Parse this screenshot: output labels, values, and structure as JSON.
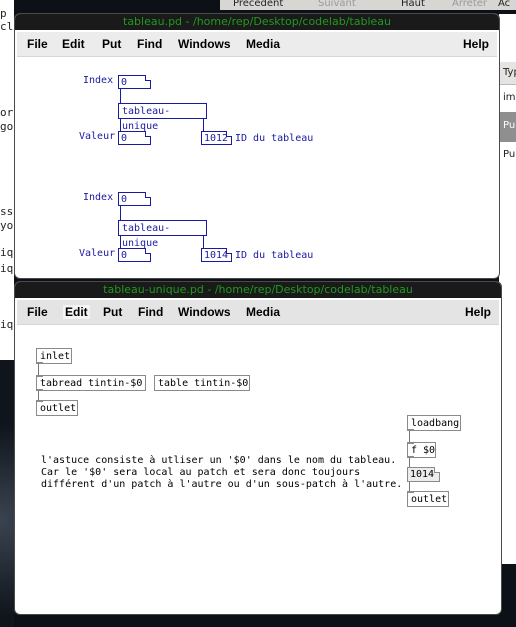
{
  "browser_bar": {
    "previous": "Précédent",
    "next": "Suivant",
    "up": "Haut",
    "stop": "Arrêter",
    "ac": "Ac"
  },
  "left_app_lines": [
    "p",
    "cl",
    "or",
    "go",
    "ss",
    "yo",
    "iq",
    "iq",
    "iq"
  ],
  "right_app": {
    "header": "Typ",
    "rows": [
      "im",
      "Pu",
      "Pu"
    ]
  },
  "window1": {
    "title": "tableau.pd  - /home/rep/Desktop/codelab/tableau",
    "menu": [
      "File",
      "Edit",
      "Put",
      "Find",
      "Windows",
      "Media",
      "Help"
    ],
    "patch1": {
      "index_label": "Index",
      "index_value": "0",
      "object": "tableau-unique",
      "valeur_label": "Valeur",
      "valeur_value": "0",
      "id_value": "1012",
      "id_label": "ID du tableau"
    },
    "patch2": {
      "index_label": "Index",
      "index_value": "0",
      "object": "tableau-unique",
      "valeur_label": "Valeur",
      "valeur_value": "0",
      "id_value": "1014",
      "id_label": "ID du tableau"
    }
  },
  "window2": {
    "title": "tableau-unique.pd  - /home/rep/Desktop/codelab/tableau",
    "menu": [
      "File",
      "Edit",
      "Put",
      "Find",
      "Windows",
      "Media",
      "Help"
    ],
    "objects": {
      "inlet": "inlet",
      "tabread": "tabread tintin-$0",
      "table": "table tintin-$0",
      "outlet1": "outlet",
      "loadbang": "loadbang",
      "f": "f $0",
      "number": "1014",
      "outlet2": "outlet"
    },
    "comment": {
      "line1": "l'astuce consiste à utliser un '$0' dans le nom du tableau.",
      "line2": "Car le '$0' sera local au patch et sera donc toujours",
      "line3": "différent d'un patch à l'autre ou d'un sous-patch à l'autre."
    }
  }
}
